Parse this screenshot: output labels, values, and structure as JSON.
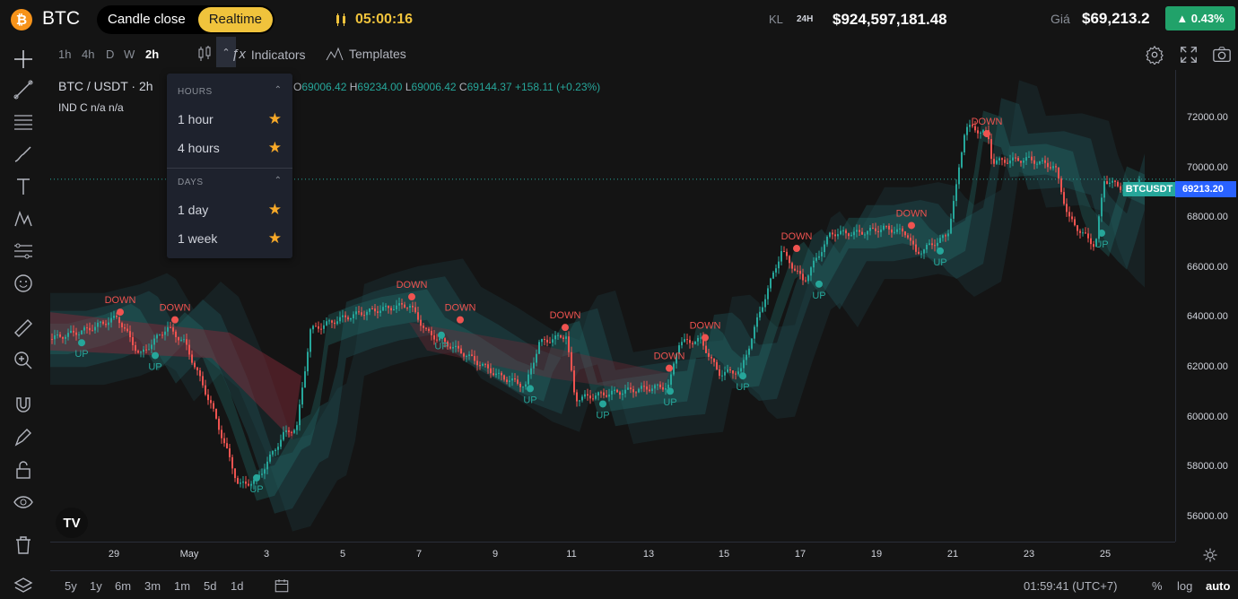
{
  "header": {
    "coin_symbol": "BTC",
    "coin_icon_glyph": "₿",
    "mode_options": [
      "Candle close",
      "Realtime"
    ],
    "active_mode": "Realtime",
    "timer": "05:00:16",
    "volume_label": "KL",
    "volume_period": "24H",
    "volume_value": "$924,597,181.48",
    "price_label": "Giá",
    "price_value": "$69,213.2",
    "change": "▲ 0.43%"
  },
  "toolbar": {
    "timeframes": [
      "1h",
      "4h",
      "D",
      "W",
      "2h"
    ],
    "active_timeframe": "2h",
    "indicators_label": "Indicators",
    "templates_label": "Templates"
  },
  "legend": {
    "pair": "BTC / USDT · 2h",
    "indicator": "IND C  n/a n/a",
    "ohlc": [
      {
        "k": "O",
        "v": "69006.42"
      },
      {
        "k": "H",
        "v": "69234.00"
      },
      {
        "k": "L",
        "v": "69006.42"
      },
      {
        "k": "C",
        "v": "69144.37"
      }
    ],
    "change": "+158.11 (+0.23%)"
  },
  "dropdown": {
    "sections": [
      {
        "title": "HOURS",
        "items": [
          "1 hour",
          "4 hours"
        ]
      },
      {
        "title": "DAYS",
        "items": [
          "1 day",
          "1 week"
        ]
      }
    ]
  },
  "chart_data": {
    "type": "candlestick",
    "y_ticks": [
      "72000.00",
      "70000.00",
      "68000.00",
      "66000.00",
      "64000.00",
      "62000.00",
      "60000.00",
      "58000.00",
      "56000.00"
    ],
    "x_ticks": [
      "29",
      "May",
      "3",
      "5",
      "7",
      "9",
      "11",
      "13",
      "15",
      "17",
      "19",
      "21",
      "23",
      "25"
    ],
    "ylim": [
      55000,
      73500
    ],
    "symbol_tag": "BTCUSDT",
    "last_price": "69213.20",
    "signals": [
      {
        "label": "UP",
        "type": "up",
        "x": "Apr 28",
        "y": 62800
      },
      {
        "label": "DOWN",
        "type": "down",
        "x": "Apr 29",
        "y": 64000
      },
      {
        "label": "UP",
        "type": "up",
        "x": "Apr 30",
        "y": 62300
      },
      {
        "label": "DOWN",
        "type": "down",
        "x": "Apr 30",
        "y": 63700
      },
      {
        "label": "UP",
        "type": "up",
        "x": "May 2",
        "y": 57500
      },
      {
        "label": "DOWN",
        "type": "down",
        "x": "May 6",
        "y": 64600
      },
      {
        "label": "UP",
        "type": "up",
        "x": "May 7",
        "y": 63100
      },
      {
        "label": "DOWN",
        "type": "down",
        "x": "May 8",
        "y": 63700
      },
      {
        "label": "UP",
        "type": "up",
        "x": "May 10",
        "y": 61000
      },
      {
        "label": "DOWN",
        "type": "down",
        "x": "May 11",
        "y": 63400
      },
      {
        "label": "UP",
        "type": "up",
        "x": "May 12",
        "y": 60400
      },
      {
        "label": "DOWN",
        "type": "down",
        "x": "May 13",
        "y": 61800
      },
      {
        "label": "UP",
        "type": "up",
        "x": "May 13",
        "y": 60900
      },
      {
        "label": "DOWN",
        "type": "down",
        "x": "May 14",
        "y": 63000
      },
      {
        "label": "UP",
        "type": "up",
        "x": "May 15",
        "y": 61500
      },
      {
        "label": "DOWN",
        "type": "down",
        "x": "May 16",
        "y": 66500
      },
      {
        "label": "UP",
        "type": "up",
        "x": "May 17",
        "y": 65100
      },
      {
        "label": "DOWN",
        "type": "down",
        "x": "May 20",
        "y": 67400
      },
      {
        "label": "UP",
        "type": "up",
        "x": "May 20",
        "y": 66400
      },
      {
        "label": "DOWN",
        "type": "down",
        "x": "May 21",
        "y": 71000
      },
      {
        "label": "UP",
        "type": "up",
        "x": "May 25",
        "y": 67100
      }
    ]
  },
  "bottom": {
    "ranges": [
      "5y",
      "1y",
      "6m",
      "3m",
      "1m",
      "5d",
      "1d"
    ],
    "time": "01:59:41 (UTC+7)",
    "percent": "%",
    "log": "log",
    "auto": "auto"
  },
  "colors": {
    "up": "#26a69a",
    "down": "#ef5350",
    "accent": "#f0c33c",
    "badge": "#21a26a",
    "price_tag": "#2962ff"
  }
}
